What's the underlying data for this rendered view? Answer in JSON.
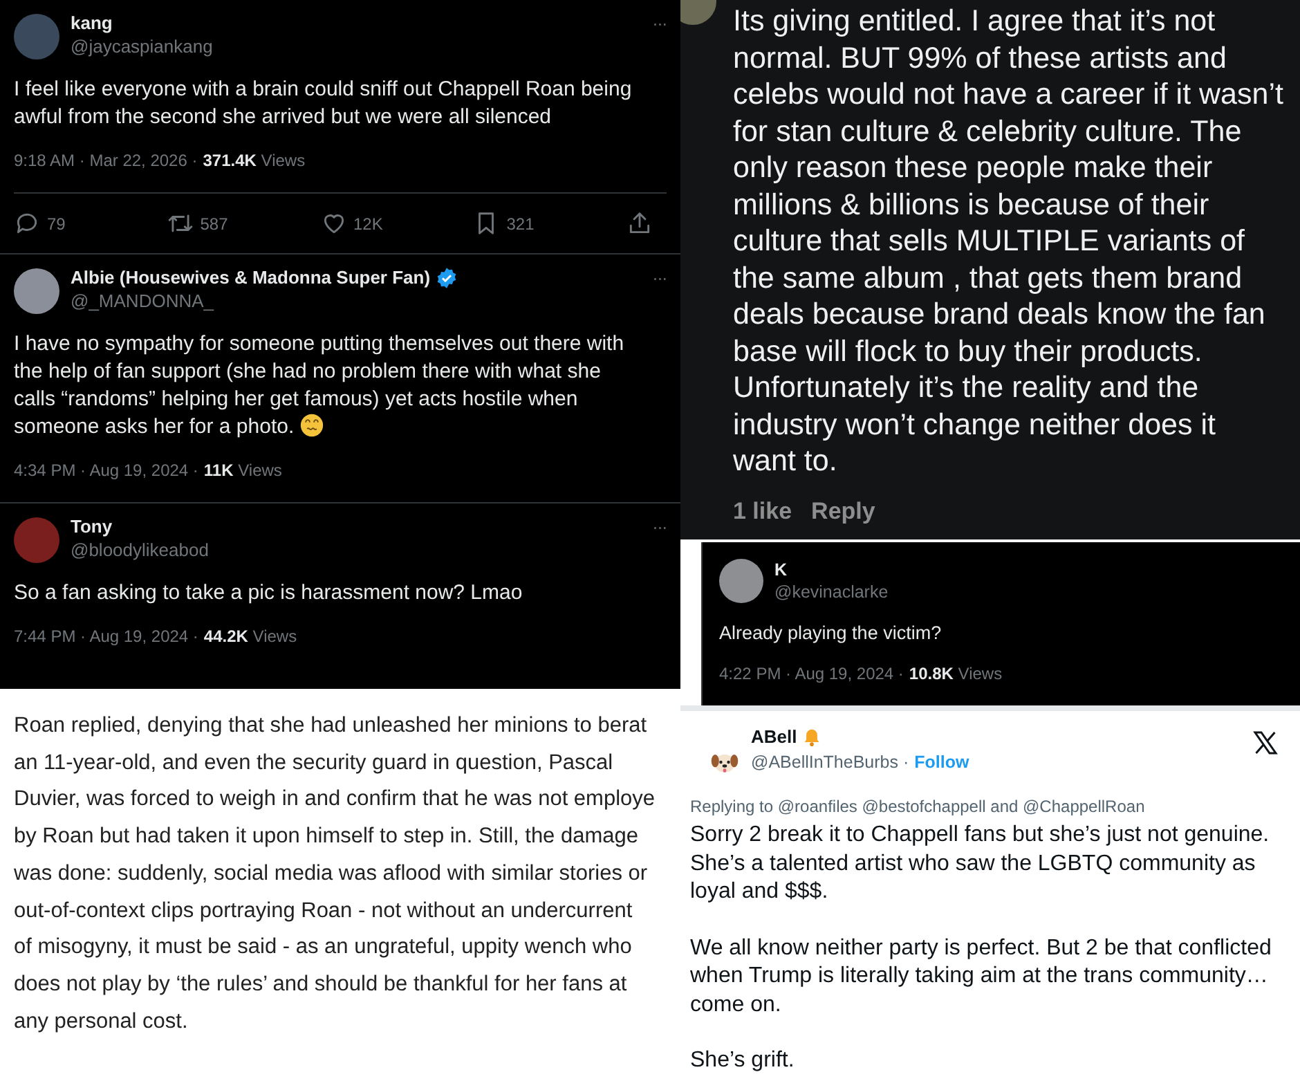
{
  "thread": [
    {
      "name": "kang",
      "handle": "@jaycaspiankang",
      "verified": false,
      "text": "I feel like everyone with a brain could sniff out Chappell Roan being awful from the second she arrived but we were all silenced",
      "emoji": false,
      "meta": "9:18 AM · Mar 22, 2026 ·",
      "views": "371.4K",
      "views_label": "Views",
      "more": "···",
      "actions": [
        {
          "kind": "reply",
          "count": "79"
        },
        {
          "kind": "repost",
          "count": "587"
        },
        {
          "kind": "like",
          "count": "12K"
        },
        {
          "kind": "bookmark",
          "count": "321"
        },
        {
          "kind": "share"
        }
      ]
    },
    {
      "name": "Albie (Housewives & Madonna Super Fan)",
      "handle": "@_MANDONNA_",
      "verified": true,
      "text": "I have no sympathy for someone putting themselves out there with the help of fan support (she had no problem there with what she calls “randoms” helping her get famous) yet acts hostile when someone asks her for a photo.",
      "emoji": true,
      "meta": "4:34 PM · Aug 19, 2024 ·",
      "views": "11K",
      "views_label": "Views",
      "more": "···"
    },
    {
      "name": "Tony",
      "handle": "@bloodylikeabod",
      "verified": false,
      "text": "So a fan asking to take a pic is harassment now? Lmao",
      "emoji": false,
      "meta": "7:44 PM · Aug 19, 2024 ·",
      "views": "44.2K",
      "views_label": "Views",
      "more": "···"
    }
  ],
  "article": {
    "lines": [
      "Roan replied, denying that she had unleashed her minions to berat",
      "an 11-year-old, and even the security guard in question, Pascal",
      "Duvier, was forced to weigh in and confirm that he was not employe",
      "by Roan but had taken it upon himself to step in. Still, the damage",
      "was done: suddenly, social media was aflood with similar stories or",
      "out-of-context clips portraying Roan - not without an undercurrent",
      "of misogyny, it must be said - as an ungrateful, uppity wench who",
      "does not play by ‘the rules’ and should be thankful for her fans at",
      "any personal cost."
    ]
  },
  "comment": {
    "text": "Its giving entitled. I agree that it’s not normal. BUT 99% of these artists and celebs would not have a career if it wasn’t for stan culture & celebrity culture. The only reason these people make their millions & billions is because of their culture that sells MULTIPLE variants of the same album , that gets them brand deals because brand deals know the fan base will flock to buy their products. Unfortunately it’s the reality and the industry won’t change neither does it want to.",
    "likes": "1 like",
    "reply": "Reply"
  },
  "reply_tweet": {
    "name": "K",
    "handle": "@kevinaclarke",
    "text": "Already playing the victim?",
    "meta": "4:22 PM · Aug 19, 2024 ·",
    "views": "10.8K",
    "views_label": "Views"
  },
  "embed": {
    "name": "ABell",
    "handle": "@ABellInTheBurbs ·",
    "follow": "Follow",
    "replying": "Replying to @roanfiles @bestofchappell and @ChappellRoan",
    "paragraphs": [
      "Sorry 2 break it to Chappell fans but she’s just not genuine. She’s a talented artist who saw the LGBTQ community as loyal and $$$.",
      "We all know neither party is perfect. But 2 be that conflicted when Trump is literally taking aim at the trans community… come on.",
      "She’s grift."
    ]
  }
}
